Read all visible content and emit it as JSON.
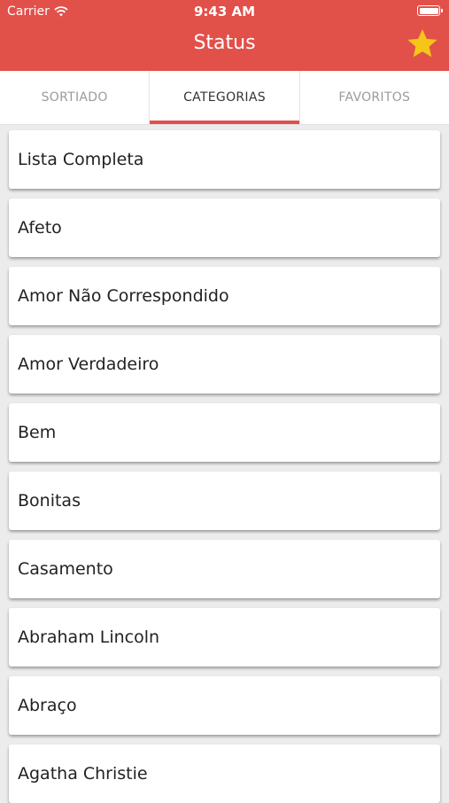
{
  "statusbar": {
    "carrier": "Carrier",
    "time": "9:43 AM"
  },
  "header": {
    "title": "Status",
    "color": "#e2504a",
    "star_color": "#f5c518"
  },
  "tabs": [
    {
      "label": "SORTIADO",
      "active": false
    },
    {
      "label": "CATEGORIAS",
      "active": true
    },
    {
      "label": "FAVORITOS",
      "active": false
    }
  ],
  "categories": [
    "Lista Completa",
    "Afeto",
    "Amor Não Correspondido",
    "Amor Verdadeiro",
    "Bem",
    "Bonitas",
    "Casamento",
    "Abraham Lincoln",
    "Abraço",
    "Agatha Christie"
  ]
}
